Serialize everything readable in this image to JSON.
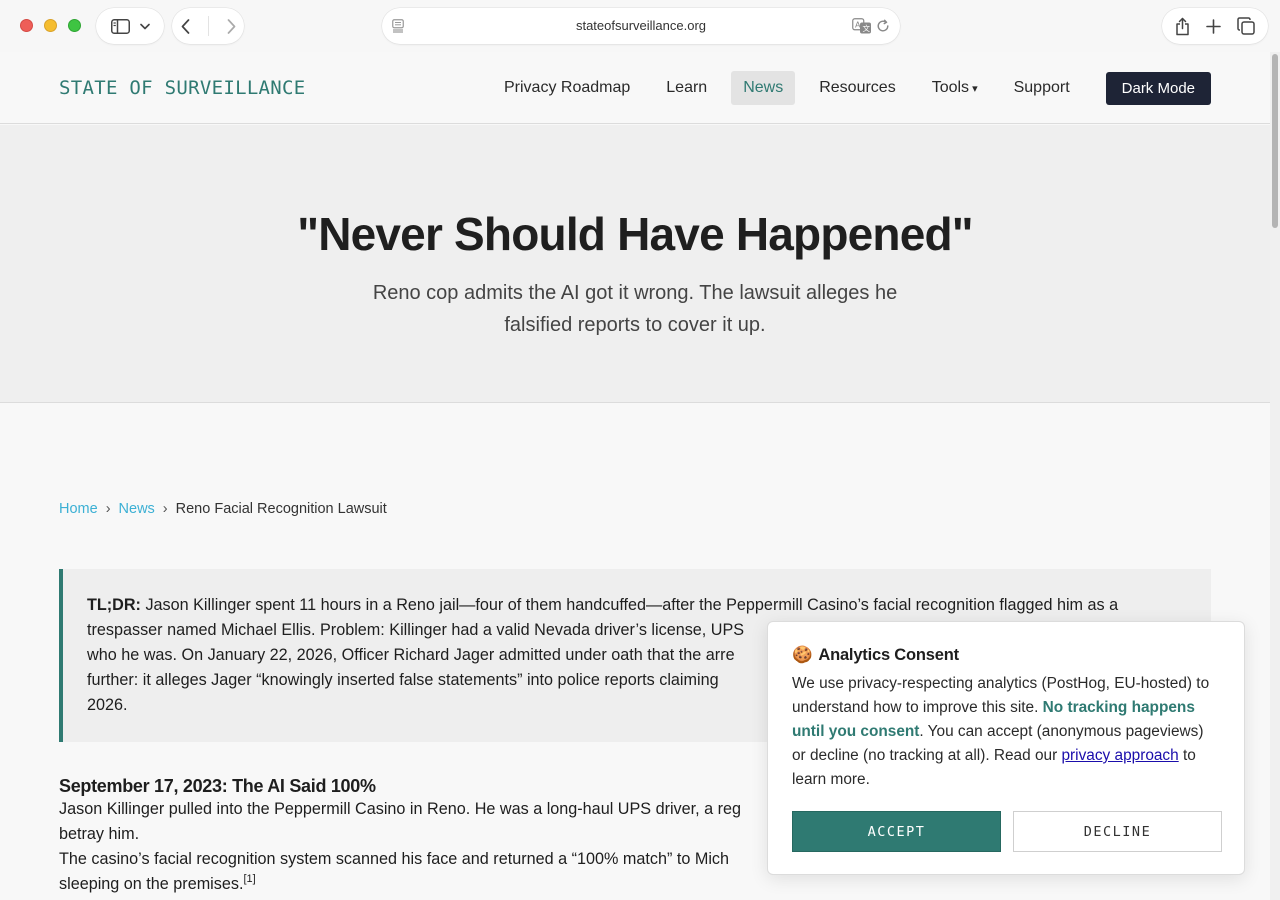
{
  "browser": {
    "url": "stateofsurveillance.org"
  },
  "site": {
    "logo": "STATE OF SURVEILLANCE",
    "nav": {
      "privacy_roadmap": "Privacy Roadmap",
      "learn": "Learn",
      "news": "News",
      "resources": "Resources",
      "tools": "Tools",
      "tools_caret": "▾",
      "support": "Support",
      "dark_mode": "Dark Mode"
    }
  },
  "hero": {
    "title": "\"Never Should Have Happened\"",
    "subtitle": "Reno cop admits the AI got it wrong. The lawsuit alleges he falsified reports to cover it up."
  },
  "breadcrumb": {
    "home": "Home",
    "news": "News",
    "current": "Reno Facial Recognition Lawsuit",
    "separator": "›"
  },
  "tldr": {
    "label": "TL;DR:",
    "lines": [
      "Jason Killinger spent 11 hours in a Reno jail—four of them handcuffed—after the Peppermill Casino’s facial recognition flagged him as a",
      "trespasser named Michael Ellis. Problem: Killinger had a valid Nevada driver’s license, UPS",
      "who he was. On January 22, 2026, Officer Richard Jager admitted under oath that the arre",
      "further: it alleges Jager “knowingly inserted false statements” into police reports claiming",
      "2026."
    ]
  },
  "article": {
    "heading": "September 17, 2023: The AI Said 100%",
    "p1_line1": "Jason Killinger pulled into the Peppermill Casino in Reno. He was a long-haul UPS driver, a reg",
    "p1_line2": "betray him.",
    "p2_line1": "The casino’s facial recognition system scanned his face and returned a “100% match” to Mich",
    "p2_line2": "sleeping on the premises.",
    "footnote": "[1]"
  },
  "consent": {
    "emoji": "🍪",
    "title": "Analytics Consent",
    "body_1": "We use privacy-respecting analytics (PostHog, EU-hosted) to understand how to improve this site. ",
    "body_highlight": "No tracking happens until you consent",
    "body_2": ". You can accept (anonymous pageviews) or decline (no tracking at all). Read our ",
    "body_link": "privacy approach",
    "body_3": " to learn more.",
    "accept": "ACCEPT",
    "decline": "DECLINE"
  },
  "colors": {
    "accent": "#2f7a72",
    "link": "#3cb0d4",
    "dark_button": "#1e2436"
  }
}
